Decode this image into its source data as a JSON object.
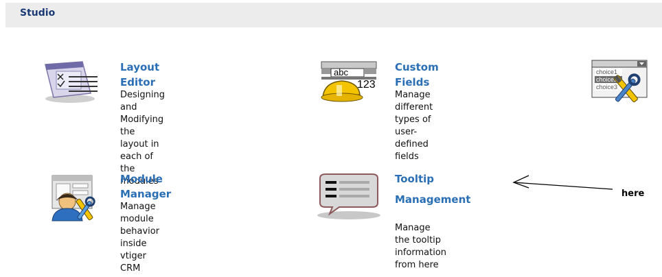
{
  "header": {
    "title": "Studio"
  },
  "tools": [
    {
      "name": "Layout Editor",
      "desc": [
        "Designing and",
        "Modifying the layout in",
        "each of the modules"
      ]
    },
    {
      "name": "Custom Fields",
      "desc": [
        "Manage different",
        "types of user-defined",
        "fields"
      ],
      "icon_text": [
        "abc",
        "123"
      ]
    },
    {
      "name": "Module Manager",
      "desc": [
        "Manage module",
        "behavior inside vtiger",
        "CRM"
      ]
    },
    {
      "name": [
        "Tooltip",
        "Management"
      ],
      "desc": [
        "Manage the tooltip",
        "information from here"
      ]
    },
    {
      "icon_text": [
        "choice1",
        "choice2",
        "choice3"
      ]
    }
  ],
  "annotation": {
    "text": "here"
  },
  "colors": {
    "link": "#2a6fb5",
    "header_bg": "#ececec",
    "header_text": "#1a3a75"
  },
  "icons": [
    "layout-editor-icon",
    "custom-fields-icon",
    "picklist-editor-icon",
    "module-manager-icon",
    "tooltip-icon",
    "arrow-icon"
  ]
}
